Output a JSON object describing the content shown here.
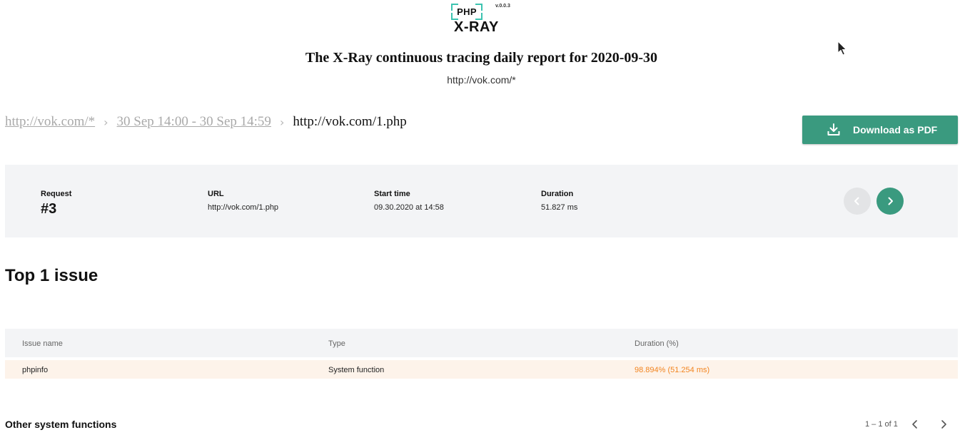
{
  "logo": {
    "php": "PHP",
    "xray": "X-RAY",
    "version": "v.0.0.3"
  },
  "report": {
    "title": "The X-Ray continuous tracing daily report for 2020-09-30",
    "subtitle": "http://vok.com/*"
  },
  "breadcrumb": {
    "items": [
      {
        "label": "http://vok.com/*"
      },
      {
        "label": "30 Sep 14:00 - 30 Sep 14:59"
      }
    ],
    "current": "http://vok.com/1.php",
    "separator": "›"
  },
  "actions": {
    "download_pdf": "Download as PDF"
  },
  "request": {
    "request_label": "Request",
    "number": "#3",
    "url_label": "URL",
    "url": "http://vok.com/1.php",
    "start_label": "Start time",
    "start": "09.30.2020 at 14:58",
    "duration_label": "Duration",
    "duration": "51.827 ms"
  },
  "issues": {
    "title": "Top 1 issue",
    "columns": [
      "Issue name",
      "Type",
      "Duration (%)"
    ],
    "rows": [
      {
        "name": "phpinfo",
        "type": "System function",
        "duration": "98.894% (51.254 ms)"
      }
    ]
  },
  "other": {
    "title": "Other system functions",
    "pagination": "1 – 1 of 1"
  },
  "colors": {
    "accent": "#3a9a7f",
    "logo_teal": "#3cc3b0",
    "highlight_row": "#fdf3ea",
    "duration_orange": "#f2841f"
  },
  "icons": {
    "download": "download-icon",
    "prev": "chevron-left-icon",
    "next": "chevron-right-icon"
  }
}
